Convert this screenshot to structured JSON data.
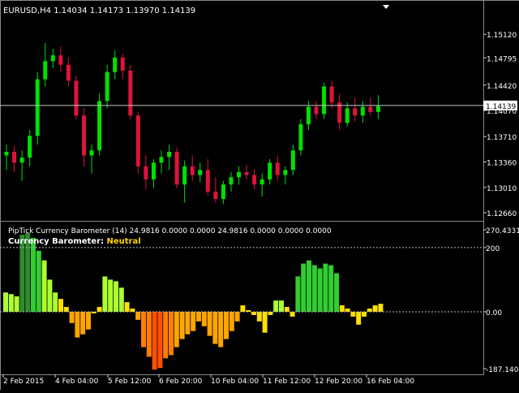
{
  "window": {
    "symbol_header": "EURUSD,H4  1.14034 1.14173 1.13970 1.14139"
  },
  "price_axis": {
    "labels": [
      "1.15120",
      "1.14795",
      "1.14420",
      "1.14070",
      "1.13710",
      "1.13360",
      "1.13010",
      "1.12660"
    ],
    "values": [
      1.1512,
      1.14795,
      1.1442,
      1.1407,
      1.1371,
      1.1336,
      1.1301,
      1.1266
    ],
    "current_price_label": "1.14139",
    "current_price": 1.14139,
    "ylim": [
      1.1256,
      1.1557
    ]
  },
  "indicator": {
    "header": "PipTick Currency Barometer (14) 24.9816 0.0000 0.0000 24.9816 0.0000 0.0000 0.0000",
    "title_prefix": "Currency Barometer: ",
    "title_value": "Neutral",
    "axis_labels": [
      "270.4331",
      "200",
      "0.00",
      "-187.1405"
    ],
    "ylim": [
      -187.1405,
      270.4331
    ],
    "level_lines": [
      200,
      0
    ]
  },
  "time_axis": {
    "labels": [
      "2 Feb 2015",
      "4 Feb 04:00",
      "5 Feb 12:00",
      "6 Feb 20:00",
      "10 Feb 04:00",
      "11 Feb 12:00",
      "12 Feb 20:00",
      "16 Feb 04:00"
    ]
  },
  "colors": {
    "background": "#000000",
    "bull": "#00E000",
    "bear": "#DC143C",
    "grid_text": "#FFFFFF",
    "neutral_title": "#FFD700",
    "hist_dark_green": "#2E8B2E",
    "hist_green": "#32CD32",
    "hist_yellow_green": "#ADFF2F",
    "hist_yellow": "#FFE000",
    "hist_orange": "#FFA500",
    "hist_dark_orange": "#FF7F00",
    "hist_red_orange": "#FF5000"
  },
  "chart_data": [
    {
      "type": "candlestick",
      "symbol": "EURUSD",
      "timeframe": "H4",
      "x_tick_labels": [
        "2 Feb 2015",
        "4 Feb 04:00",
        "5 Feb 12:00",
        "6 Feb 20:00",
        "10 Feb 04:00",
        "11 Feb 12:00",
        "12 Feb 20:00",
        "16 Feb 04:00"
      ],
      "ylim": [
        1.1256,
        1.1557
      ],
      "candles": [
        {
          "o": 1.1345,
          "h": 1.136,
          "l": 1.1325,
          "c": 1.135
        },
        {
          "o": 1.135,
          "h": 1.1358,
          "l": 1.1322,
          "c": 1.1335
        },
        {
          "o": 1.1335,
          "h": 1.1352,
          "l": 1.131,
          "c": 1.1342
        },
        {
          "o": 1.1342,
          "h": 1.138,
          "l": 1.133,
          "c": 1.1372
        },
        {
          "o": 1.1372,
          "h": 1.146,
          "l": 1.136,
          "c": 1.145
        },
        {
          "o": 1.145,
          "h": 1.15,
          "l": 1.144,
          "c": 1.1475
        },
        {
          "o": 1.1475,
          "h": 1.1492,
          "l": 1.1465,
          "c": 1.1483
        },
        {
          "o": 1.1483,
          "h": 1.1495,
          "l": 1.146,
          "c": 1.147
        },
        {
          "o": 1.147,
          "h": 1.148,
          "l": 1.144,
          "c": 1.1448
        },
        {
          "o": 1.1448,
          "h": 1.1455,
          "l": 1.1395,
          "c": 1.14
        },
        {
          "o": 1.14,
          "h": 1.141,
          "l": 1.133,
          "c": 1.1345
        },
        {
          "o": 1.1345,
          "h": 1.136,
          "l": 1.132,
          "c": 1.1352
        },
        {
          "o": 1.1352,
          "h": 1.143,
          "l": 1.1345,
          "c": 1.142
        },
        {
          "o": 1.142,
          "h": 1.147,
          "l": 1.141,
          "c": 1.146
        },
        {
          "o": 1.146,
          "h": 1.149,
          "l": 1.145,
          "c": 1.148
        },
        {
          "o": 1.148,
          "h": 1.1485,
          "l": 1.145,
          "c": 1.1462
        },
        {
          "o": 1.1462,
          "h": 1.147,
          "l": 1.1395,
          "c": 1.14
        },
        {
          "o": 1.14,
          "h": 1.1405,
          "l": 1.132,
          "c": 1.133
        },
        {
          "o": 1.133,
          "h": 1.1345,
          "l": 1.1298,
          "c": 1.1312
        },
        {
          "o": 1.1312,
          "h": 1.134,
          "l": 1.13,
          "c": 1.1335
        },
        {
          "o": 1.1335,
          "h": 1.1352,
          "l": 1.132,
          "c": 1.1343
        },
        {
          "o": 1.1343,
          "h": 1.136,
          "l": 1.1325,
          "c": 1.135
        },
        {
          "o": 1.135,
          "h": 1.1356,
          "l": 1.13,
          "c": 1.1305
        },
        {
          "o": 1.1305,
          "h": 1.1338,
          "l": 1.128,
          "c": 1.133
        },
        {
          "o": 1.133,
          "h": 1.1345,
          "l": 1.131,
          "c": 1.1318
        },
        {
          "o": 1.1318,
          "h": 1.1335,
          "l": 1.1308,
          "c": 1.1325
        },
        {
          "o": 1.1325,
          "h": 1.134,
          "l": 1.129,
          "c": 1.1295
        },
        {
          "o": 1.1295,
          "h": 1.1315,
          "l": 1.128,
          "c": 1.1285
        },
        {
          "o": 1.1285,
          "h": 1.131,
          "l": 1.1278,
          "c": 1.1305
        },
        {
          "o": 1.1305,
          "h": 1.1322,
          "l": 1.1295,
          "c": 1.1315
        },
        {
          "o": 1.1315,
          "h": 1.133,
          "l": 1.1305,
          "c": 1.1322
        },
        {
          "o": 1.1322,
          "h": 1.1332,
          "l": 1.1312,
          "c": 1.1318
        },
        {
          "o": 1.1318,
          "h": 1.1326,
          "l": 1.1298,
          "c": 1.1305
        },
        {
          "o": 1.1305,
          "h": 1.132,
          "l": 1.1288,
          "c": 1.1312
        },
        {
          "o": 1.1312,
          "h": 1.134,
          "l": 1.1305,
          "c": 1.1335
        },
        {
          "o": 1.1335,
          "h": 1.1345,
          "l": 1.131,
          "c": 1.1318
        },
        {
          "o": 1.1318,
          "h": 1.133,
          "l": 1.1305,
          "c": 1.1325
        },
        {
          "o": 1.1325,
          "h": 1.136,
          "l": 1.1318,
          "c": 1.1352
        },
        {
          "o": 1.1352,
          "h": 1.1395,
          "l": 1.1345,
          "c": 1.1388
        },
        {
          "o": 1.1388,
          "h": 1.142,
          "l": 1.138,
          "c": 1.1412
        },
        {
          "o": 1.1412,
          "h": 1.142,
          "l": 1.1395,
          "c": 1.1402
        },
        {
          "o": 1.1402,
          "h": 1.1445,
          "l": 1.1395,
          "c": 1.144
        },
        {
          "o": 1.144,
          "h": 1.1448,
          "l": 1.141,
          "c": 1.1418
        },
        {
          "o": 1.1418,
          "h": 1.143,
          "l": 1.138,
          "c": 1.139
        },
        {
          "o": 1.139,
          "h": 1.1418,
          "l": 1.1385,
          "c": 1.141
        },
        {
          "o": 1.141,
          "h": 1.1425,
          "l": 1.1392,
          "c": 1.14
        },
        {
          "o": 1.14,
          "h": 1.142,
          "l": 1.139,
          "c": 1.1412
        },
        {
          "o": 1.1412,
          "h": 1.1425,
          "l": 1.14,
          "c": 1.1405
        },
        {
          "o": 1.1405,
          "h": 1.1428,
          "l": 1.1395,
          "c": 1.1413
        }
      ]
    },
    {
      "type": "bar",
      "name": "PipTick Currency Barometer (14)",
      "ylim": [
        -187.1405,
        270.4331
      ],
      "values": [
        60,
        55,
        48,
        240,
        245,
        230,
        190,
        160,
        100,
        60,
        40,
        15,
        -35,
        -80,
        -70,
        -55,
        -5,
        15,
        110,
        100,
        95,
        75,
        30,
        10,
        -25,
        -110,
        -140,
        -180,
        -175,
        -145,
        -135,
        -110,
        -85,
        -70,
        -60,
        -30,
        -45,
        -75,
        -100,
        -110,
        -85,
        -60,
        -30,
        20,
        5,
        -10,
        -30,
        -65,
        -10,
        35,
        35,
        15,
        -15,
        110,
        150,
        160,
        145,
        135,
        150,
        145,
        120,
        20,
        10,
        -15,
        -40,
        -15,
        10,
        20,
        25
      ],
      "colors": [
        "yellow-green",
        "yellow-green",
        "yellow-green",
        "dark-green",
        "dark-green",
        "green",
        "green",
        "yellow-green",
        "yellow-green",
        "yellow-green",
        "yellow",
        "yellow",
        "orange",
        "orange",
        "orange",
        "orange",
        "yellow",
        "yellow",
        "yellow-green",
        "yellow-green",
        "yellow-green",
        "yellow-green",
        "yellow",
        "yellow",
        "orange",
        "dark-orange",
        "dark-orange",
        "red-orange",
        "red-orange",
        "dark-orange",
        "dark-orange",
        "orange",
        "orange",
        "orange",
        "orange",
        "orange",
        "orange",
        "orange",
        "orange",
        "orange",
        "orange",
        "orange",
        "orange",
        "yellow",
        "yellow",
        "yellow",
        "yellow",
        "yellow",
        "yellow",
        "yellow-green",
        "yellow-green",
        "yellow",
        "yellow",
        "green",
        "green",
        "green",
        "green",
        "green",
        "green",
        "green",
        "green",
        "yellow",
        "yellow",
        "yellow",
        "yellow",
        "yellow",
        "yellow",
        "yellow",
        "yellow"
      ]
    }
  ]
}
